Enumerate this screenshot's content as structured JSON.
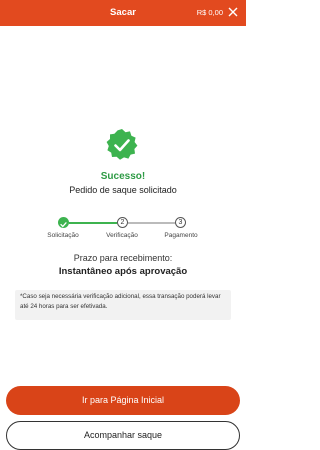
{
  "header": {
    "title": "Sacar",
    "balance": "R$ 0,00",
    "close_icon": "close-icon"
  },
  "status": {
    "icon": "check-badge-icon",
    "title": "Sucesso!",
    "subtitle": "Pedido de saque solicitado"
  },
  "steps": [
    {
      "number": "",
      "label": "Solicitação",
      "state": "done"
    },
    {
      "number": "2",
      "label": "Verificação",
      "state": "pending"
    },
    {
      "number": "3",
      "label": "Pagamento",
      "state": "pending"
    }
  ],
  "deadline": {
    "label": "Prazo para recebimento:",
    "value": "Instantâneo após aprovação"
  },
  "note": "*Caso seja necessária verificação adicional, essa transação poderá levar até 24 horas para ser efetivada.",
  "buttons": {
    "home": "Ir para Página Inicial",
    "track": "Acompanhar saque"
  },
  "colors": {
    "brand": "#e24a1f",
    "success": "#3db34f"
  }
}
